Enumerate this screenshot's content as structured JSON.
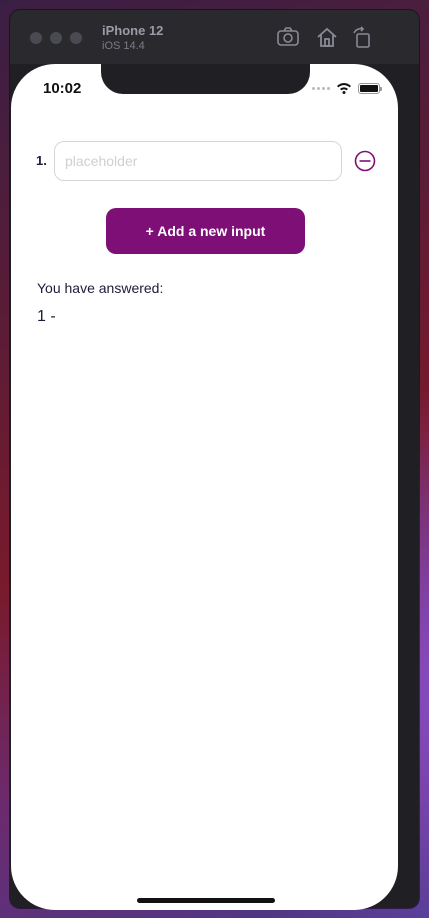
{
  "simulator": {
    "device_name": "iPhone 12",
    "os_version": "iOS 14.4",
    "icons": [
      "screenshot-icon",
      "home-icon",
      "rotate-icon"
    ]
  },
  "status_bar": {
    "time": "10:02"
  },
  "form": {
    "inputs": [
      {
        "index_label": "1.",
        "value": "",
        "placeholder": "placeholder"
      }
    ],
    "add_button_label": "+ Add a new input"
  },
  "answers": {
    "heading": "You have answered:",
    "lines": [
      "1 -"
    ]
  },
  "colors": {
    "accent": "#7e0f76",
    "text": "#1c1c3a"
  }
}
